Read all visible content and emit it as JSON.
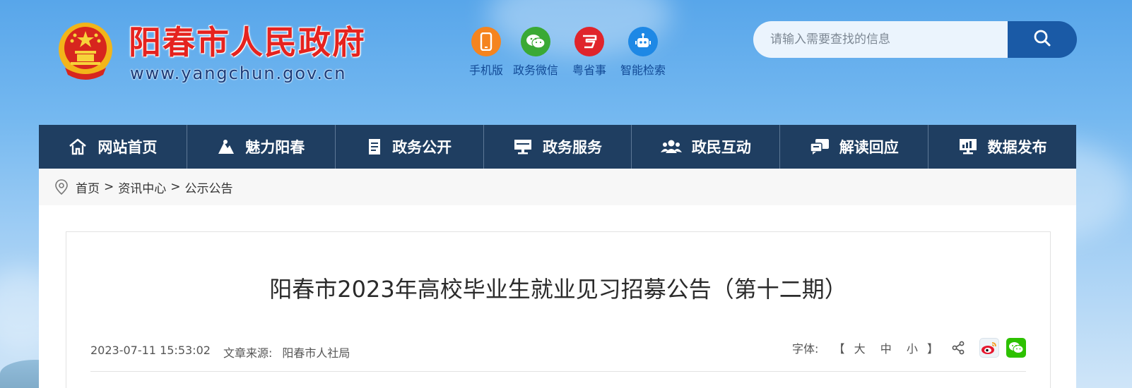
{
  "header": {
    "title": "阳春市人民政府",
    "url": "www.yangchun.gov.cn",
    "quick_links": [
      {
        "label": "手机版",
        "icon": "mobile-icon",
        "color": "#f5841f"
      },
      {
        "label": "政务微信",
        "icon": "wechat-icon",
        "color": "#3aa935"
      },
      {
        "label": "粤省事",
        "icon": "yueshengshi-icon",
        "color": "#e0242b"
      },
      {
        "label": "智能检索",
        "icon": "robot-icon",
        "color": "#1e88e5"
      }
    ],
    "search": {
      "placeholder": "请输入需要查找的信息"
    }
  },
  "nav": {
    "items": [
      {
        "label": "网站首页",
        "icon": "home-icon"
      },
      {
        "label": "魅力阳春",
        "icon": "scenery-icon"
      },
      {
        "label": "政务公开",
        "icon": "document-icon"
      },
      {
        "label": "政务服务",
        "icon": "monitor-icon"
      },
      {
        "label": "政民互动",
        "icon": "people-icon"
      },
      {
        "label": "解读回应",
        "icon": "chat-icon"
      },
      {
        "label": "数据发布",
        "icon": "data-icon"
      }
    ]
  },
  "breadcrumb": {
    "items": [
      "首页",
      "资讯中心",
      "公示公告"
    ],
    "separator": ">"
  },
  "article": {
    "title": "阳春市2023年高校毕业生就业见习招募公告（第十二期）",
    "datetime": "2023-07-11 15:53:02",
    "source_label": "文章来源:",
    "source": "阳春市人社局",
    "font_label": "字体:",
    "bracket_open": "【",
    "font_sizes": [
      "大",
      "中",
      "小"
    ],
    "bracket_close": "】"
  },
  "colors": {
    "nav_bg": "#1f3e61",
    "title_red": "#e5231f",
    "search_btn": "#1a5aa6"
  }
}
